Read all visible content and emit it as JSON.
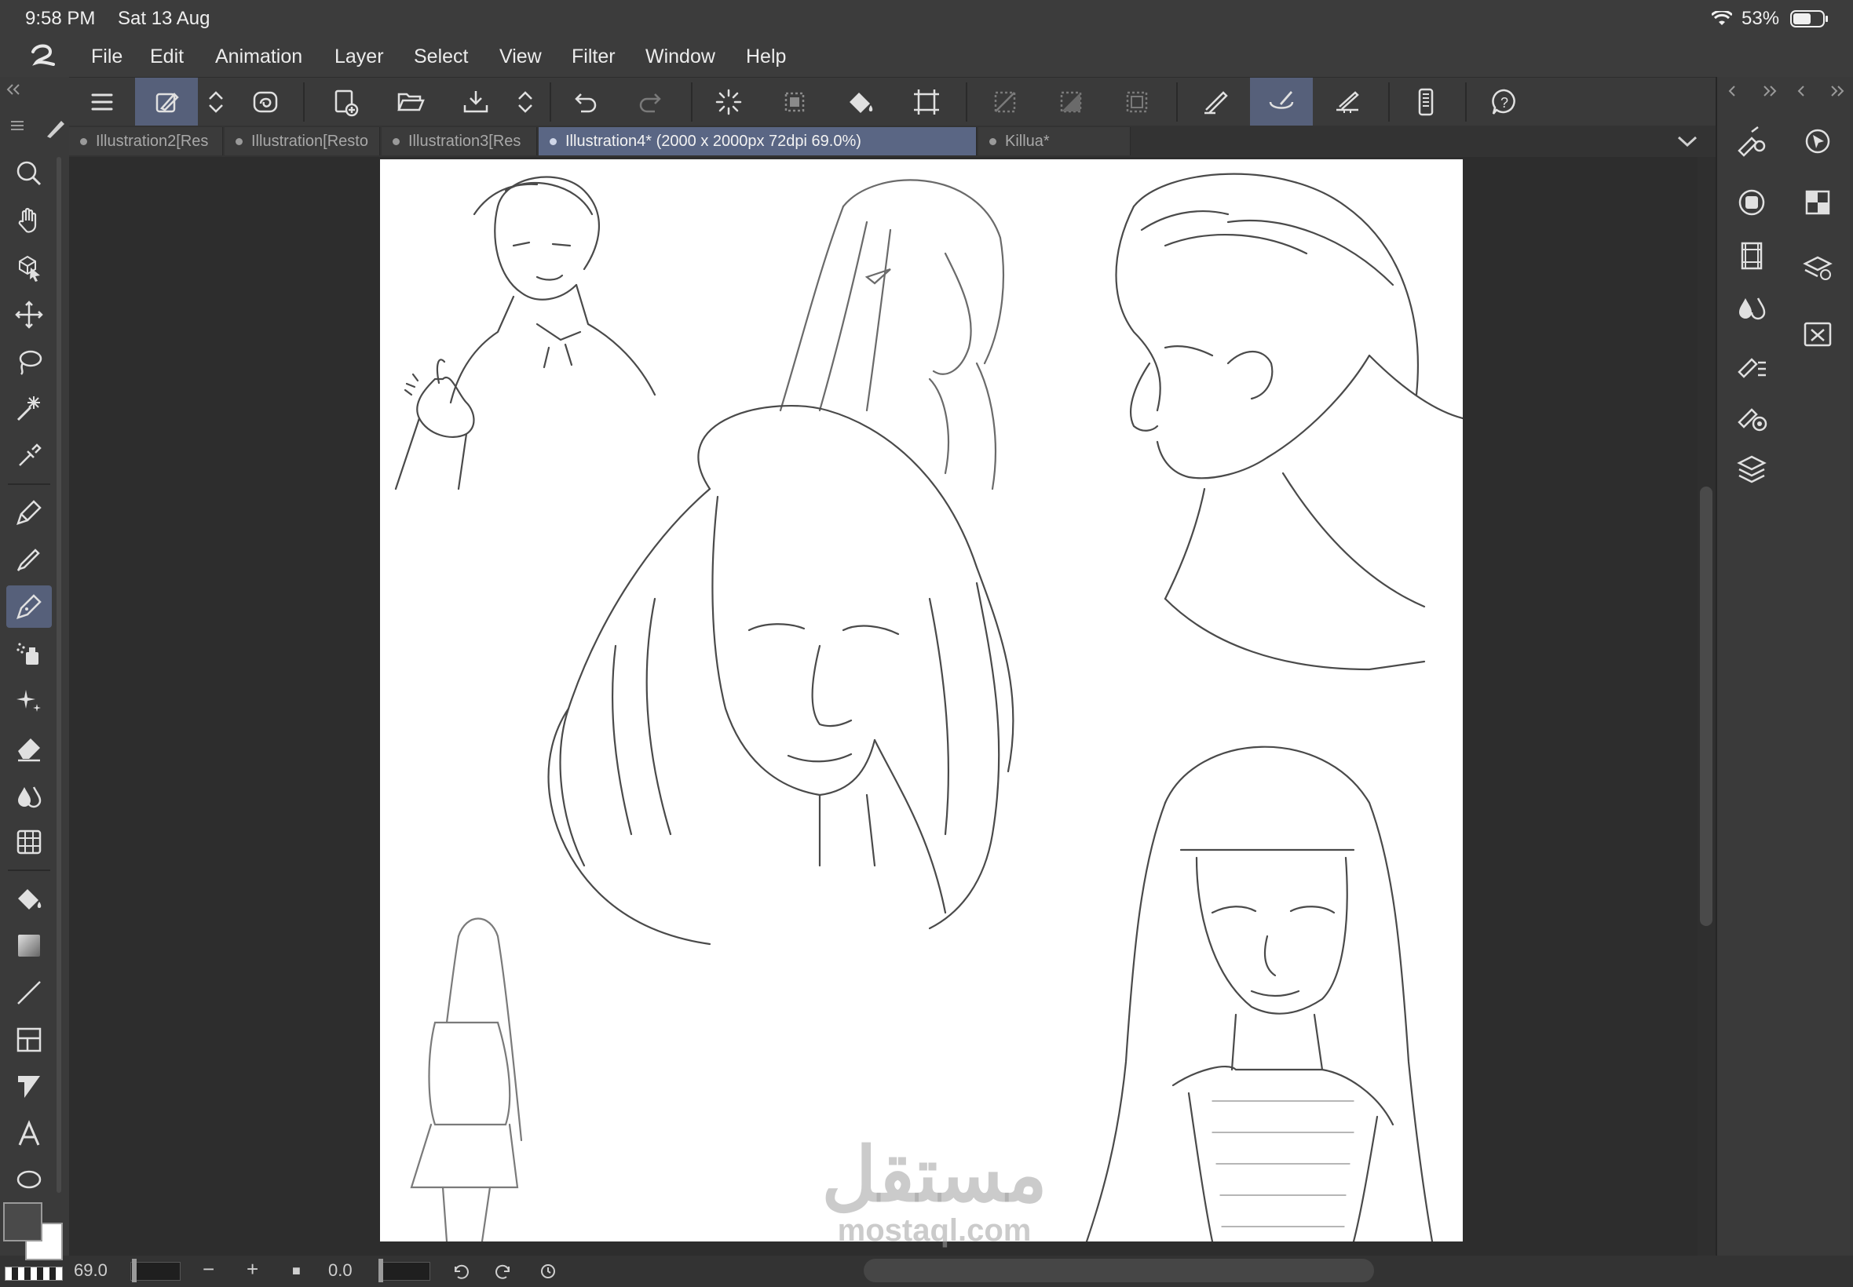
{
  "status_bar": {
    "time": "9:58 PM",
    "date": "Sat 13 Aug",
    "battery": "53%"
  },
  "menu": {
    "items": [
      "File",
      "Edit",
      "Animation",
      "Layer",
      "Select",
      "View",
      "Filter",
      "Window",
      "Help"
    ]
  },
  "toolbar": {
    "icons": [
      "hamburger-menu-icon",
      "quick-access-icon",
      "spinner-arrows-icon",
      "spiral-icon",
      "new-file-icon",
      "open-folder-icon",
      "save-tray-icon",
      "spinner-arrows-icon",
      "undo-icon",
      "redo-icon",
      "loading-spinner-icon",
      "selection-dotted-icon",
      "paint-bucket-icon",
      "transform-crop-icon",
      "deselect-icon",
      "invert-selection-icon",
      "selection-border-icon",
      "sketch-pen-icon",
      "brush-highlight-icon",
      "ruler-pen-icon",
      "device-settings-icon",
      "help-icon"
    ]
  },
  "tabs": [
    {
      "label": "Illustration2[Res",
      "active": false
    },
    {
      "label": "Illustration[Resto",
      "active": false
    },
    {
      "label": "Illustration3[Res",
      "active": false
    },
    {
      "label": "Illustration4* (2000 x 2000px 72dpi 69.0%)",
      "active": true
    },
    {
      "label": "Killua*",
      "active": false
    }
  ],
  "left_tools": [
    "zoom-icon",
    "hand-icon",
    "object-select-icon",
    "move-icon",
    "lasso-icon",
    "magic-wand-icon",
    "eyedropper-icon",
    "pen-icon",
    "pencil-icon",
    "brush-pen-icon",
    "airbrush-icon",
    "decoration-icon",
    "eraser-icon",
    "blend-icon",
    "grid-icon",
    "fill-icon",
    "gradient-icon",
    "line-icon",
    "frame-icon",
    "balloon-icon",
    "text-icon",
    "ellipse-icon"
  ],
  "right_panel": {
    "icons": [
      "collapse-left-icon",
      "expand-right-icon",
      "collapse-left-icon",
      "expand-right-icon",
      "tool-property-icon",
      "navigator-icon",
      "sub-tool-icon",
      "color-set-icon",
      "animation-timeline-icon",
      "layer-property-icon",
      "color-mix-icon",
      "material-icon",
      "vector-tool-icon",
      "brush-size-icon",
      "layers-icon"
    ]
  },
  "bottom_bar": {
    "zoom_value": "69.0",
    "rotation_value": "0.0",
    "zoom_out": "−",
    "zoom_in": "+",
    "stop": "■"
  },
  "colors": {
    "main": "#4a4a4a",
    "sub": "#ffffff",
    "accent": "#56607a"
  },
  "watermark": {
    "arabic": "مستقل",
    "latin": "mostaql.com"
  }
}
